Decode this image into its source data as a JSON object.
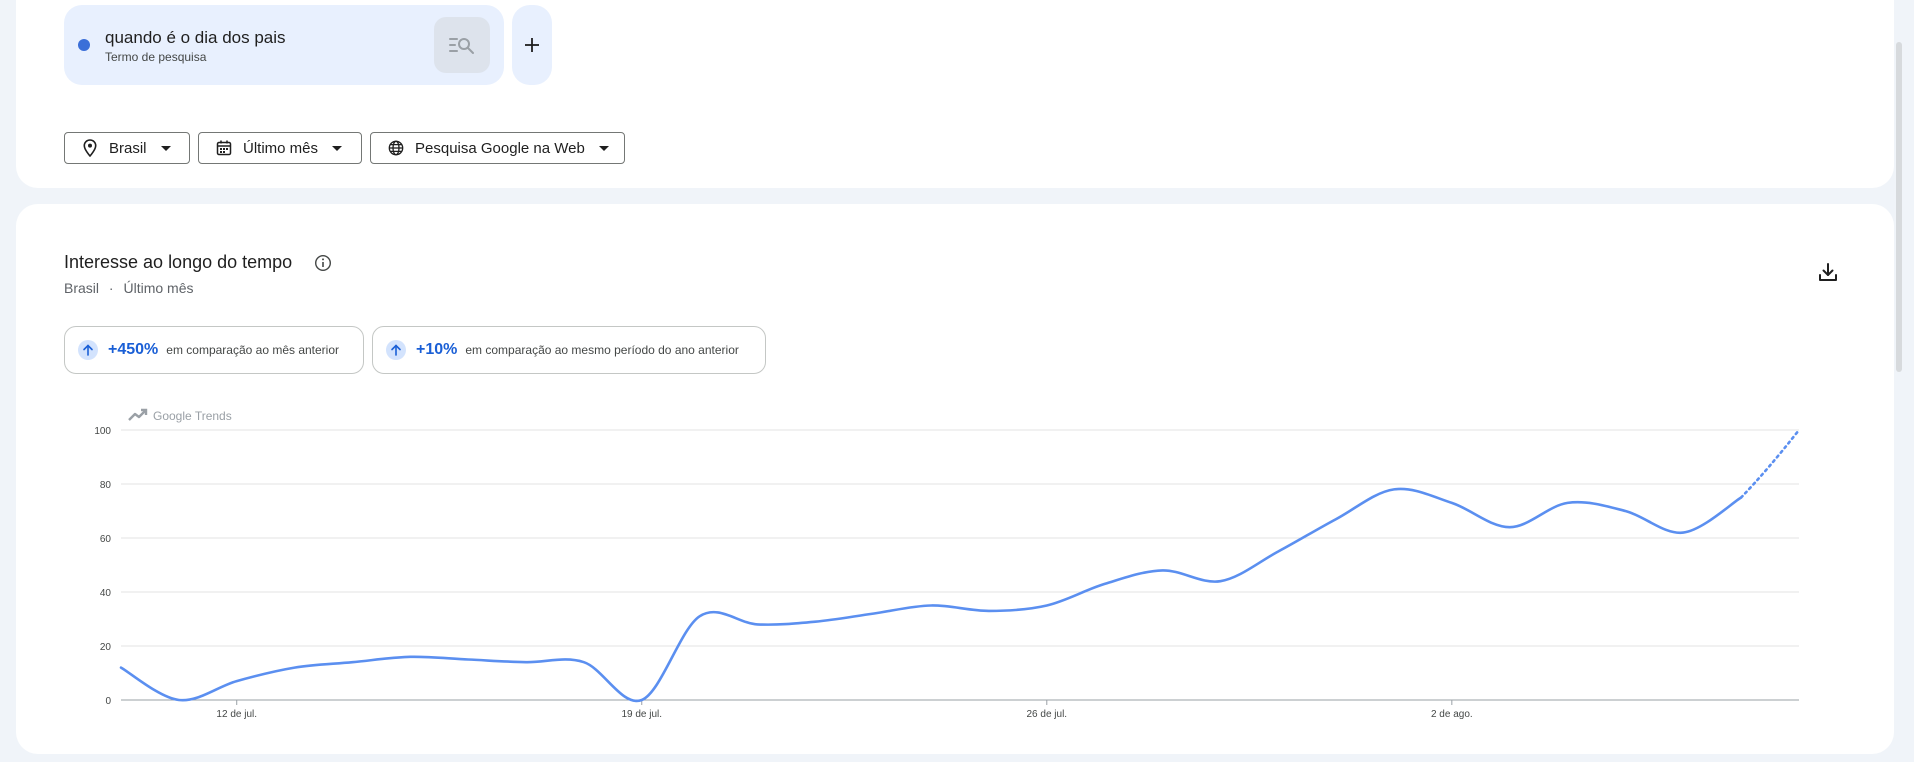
{
  "search": {
    "term": "quando é o dia dos pais",
    "term_type": "Termo de pesquisa",
    "series_color": "#3b6fd8",
    "add_icon": "plus-icon",
    "term_button_icon": "search-list-icon"
  },
  "filters": {
    "location": "Brasil",
    "time_range": "Último mês",
    "property": "Pesquisa Google na Web"
  },
  "interest": {
    "title": "Interesse ao longo do tempo",
    "subtitle_location": "Brasil",
    "subtitle_separator": "·",
    "subtitle_time": "Último mês",
    "stat1_value": "+450%",
    "stat1_text": "em comparação ao mês anterior",
    "stat2_value": "+10%",
    "stat2_text": "em comparação ao mesmo período do ano anterior",
    "watermark": "Google Trends"
  },
  "chart_data": {
    "type": "line",
    "title": "Interesse ao longo do tempo",
    "xlabel": "",
    "ylabel": "",
    "ylim": [
      0,
      100
    ],
    "yticks": [
      0,
      20,
      40,
      60,
      80,
      100
    ],
    "xticks": [
      {
        "label": "12 de jul.",
        "day": 3
      },
      {
        "label": "19 de jul.",
        "day": 10
      },
      {
        "label": "26 de jul.",
        "day": 17
      },
      {
        "label": "2 de ago.",
        "day": 24
      }
    ],
    "grid": true,
    "legend": "none",
    "series": [
      {
        "color": "#5b8ff0",
        "days": [
          1,
          2,
          3,
          4,
          5,
          6,
          7,
          8,
          9,
          10,
          11,
          12,
          13,
          14,
          15,
          16,
          17,
          18,
          19,
          20,
          21,
          22,
          23,
          24,
          25,
          26,
          27,
          28,
          29
        ],
        "values": [
          12,
          0,
          7,
          12,
          14,
          16,
          15,
          14,
          14,
          0,
          31,
          28,
          29,
          32,
          35,
          33,
          35,
          43,
          48,
          44,
          55,
          67,
          78,
          73,
          64,
          73,
          70,
          62,
          75
        ],
        "partial_from_index": 28,
        "partial_value": 100
      }
    ]
  }
}
